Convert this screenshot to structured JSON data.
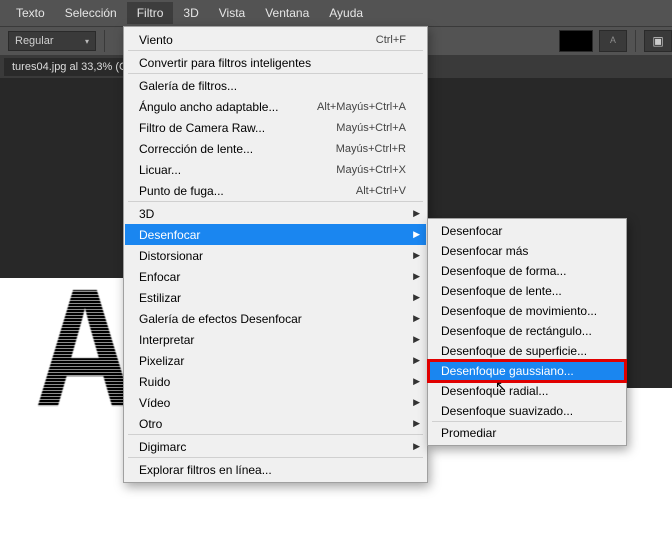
{
  "menubar": {
    "items": [
      "Texto",
      "Selección",
      "Filtro",
      "3D",
      "Vista",
      "Ventana",
      "Ayuda"
    ],
    "active_index": 2
  },
  "toolbar": {
    "regular": "Regular"
  },
  "tab": {
    "title": "tures04.jpg al 33,3% (C"
  },
  "dropdown": {
    "items": [
      {
        "label": "Viento",
        "shortcut": "Ctrl+F",
        "sep": true
      },
      {
        "label": "Convertir para filtros inteligentes",
        "sep": true
      },
      {
        "label": "Galería de filtros..."
      },
      {
        "label": "Ángulo ancho adaptable...",
        "shortcut": "Alt+Mayús+Ctrl+A"
      },
      {
        "label": "Filtro de Camera Raw...",
        "shortcut": "Mayús+Ctrl+A"
      },
      {
        "label": "Corrección de lente...",
        "shortcut": "Mayús+Ctrl+R"
      },
      {
        "label": "Licuar...",
        "shortcut": "Mayús+Ctrl+X"
      },
      {
        "label": "Punto de fuga...",
        "shortcut": "Alt+Ctrl+V",
        "sep": true
      },
      {
        "label": "3D",
        "arrow": true
      },
      {
        "label": "Desenfocar",
        "arrow": true,
        "highlight": true
      },
      {
        "label": "Distorsionar",
        "arrow": true
      },
      {
        "label": "Enfocar",
        "arrow": true
      },
      {
        "label": "Estilizar",
        "arrow": true
      },
      {
        "label": "Galería de efectos Desenfocar",
        "arrow": true
      },
      {
        "label": "Interpretar",
        "arrow": true
      },
      {
        "label": "Pixelizar",
        "arrow": true
      },
      {
        "label": "Ruido",
        "arrow": true
      },
      {
        "label": "Vídeo",
        "arrow": true
      },
      {
        "label": "Otro",
        "arrow": true,
        "sep": true
      },
      {
        "label": "Digimarc",
        "arrow": true,
        "sep": true
      },
      {
        "label": "Explorar filtros en línea..."
      }
    ]
  },
  "submenu": {
    "items": [
      {
        "label": "Desenfocar"
      },
      {
        "label": "Desenfocar más"
      },
      {
        "label": "Desenfoque de forma..."
      },
      {
        "label": "Desenfoque de lente..."
      },
      {
        "label": "Desenfoque de movimiento..."
      },
      {
        "label": "Desenfoque de rectángulo..."
      },
      {
        "label": "Desenfoque de superficie..."
      },
      {
        "label": "Desenfoque gaussiano...",
        "redbox": true
      },
      {
        "label": "Desenfoque radial..."
      },
      {
        "label": "Desenfoque suavizado...",
        "sep": true
      },
      {
        "label": "Promediar"
      }
    ]
  },
  "canvas": {
    "letter": "A"
  }
}
